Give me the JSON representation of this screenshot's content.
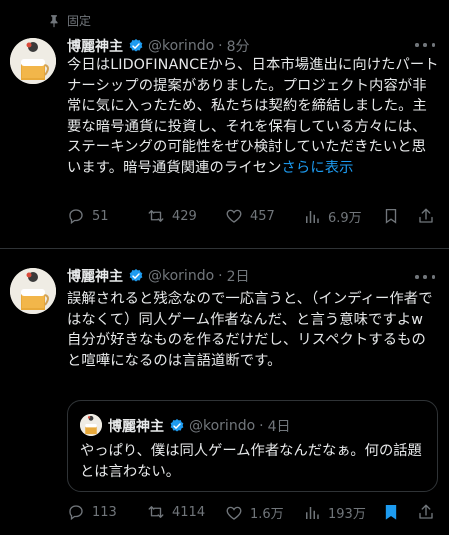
{
  "pinned": {
    "label": "固定",
    "icon": "pin-icon"
  },
  "tweets": [
    {
      "author": {
        "name": "博麗神主",
        "handle": "@korindo",
        "verified": true
      },
      "time": "8分",
      "text": "今日はLIDOFINANCEから、日本市場進出に向けたパートナーシップの提案がありました。プロジェクト内容が非常に気に入ったため、私たちは契約を締結しました。主要な暗号通貨に投資し、それを保有している方々には、ステーキングの可能性をぜひ検討していただきたいと思います。暗号通貨関連のライセン",
      "show_more": "さらに表示",
      "stats": {
        "replies": "51",
        "retweets": "429",
        "likes": "457",
        "views": "6.9万"
      }
    },
    {
      "author": {
        "name": "博麗神主",
        "handle": "@korindo",
        "verified": true
      },
      "time": "2日",
      "text": "誤解されると残念なので一応言うと、（インディー作者ではなくて）同人ゲーム作者なんだ、と言う意味ですよw\n自分が好きなものを作るだけだし、リスペクトするものと喧嘩になるのは言語道断です。",
      "quote": {
        "author": {
          "name": "博麗神主",
          "handle": "@korindo",
          "verified": true
        },
        "time": "4日",
        "text": "やっぱり、僕は同人ゲーム作者なんだなぁ。何の話題とは言わない。"
      },
      "stats": {
        "replies": "113",
        "retweets": "4114",
        "likes": "1.6万",
        "views": "193万"
      }
    }
  ],
  "colors": {
    "accent": "#1d9bf0",
    "muted": "#71767b",
    "text": "#e7e9ea",
    "background": "#000000",
    "divider": "#2f3336"
  }
}
